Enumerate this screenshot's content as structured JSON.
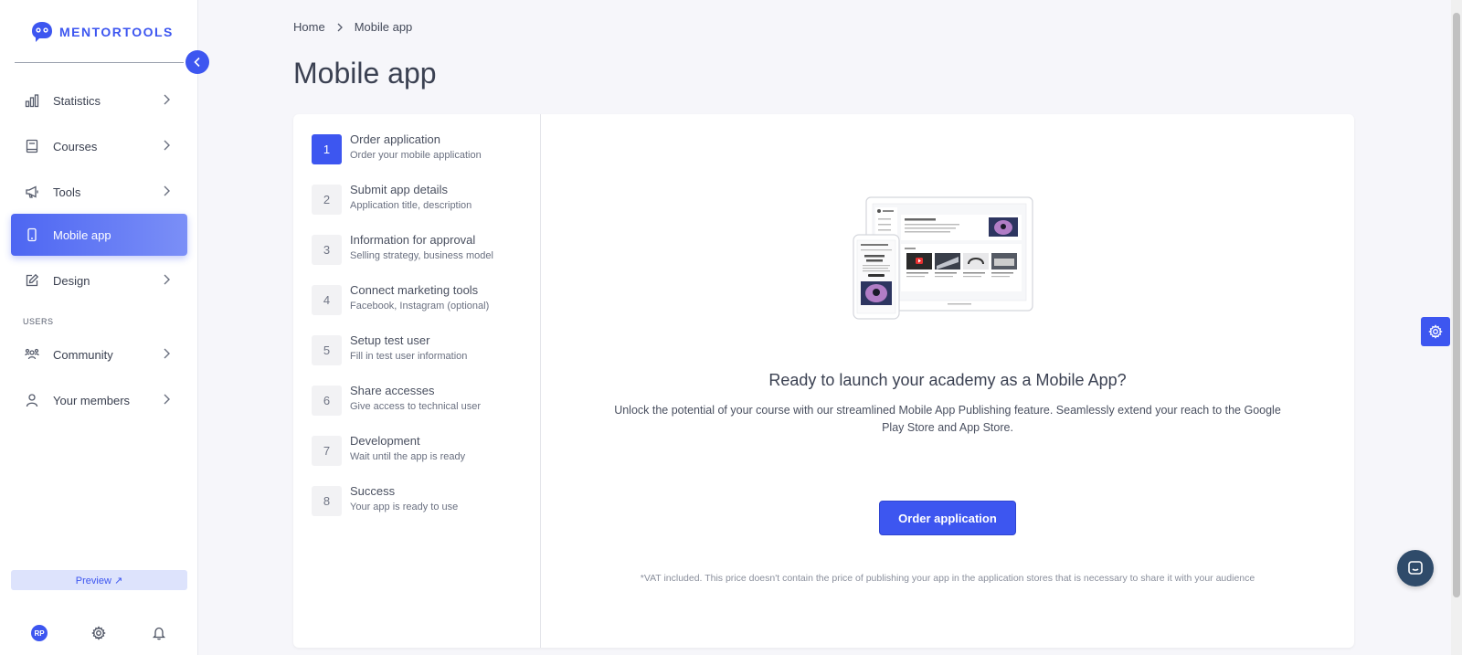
{
  "brand": {
    "name": "MENTORTOOLS",
    "accent": "#3d56f0"
  },
  "sidebar": {
    "items": [
      {
        "label": "Statistics",
        "icon": "bar-chart-icon"
      },
      {
        "label": "Courses",
        "icon": "book-icon"
      },
      {
        "label": "Tools",
        "icon": "megaphone-icon"
      },
      {
        "label": "Mobile app",
        "icon": "phone-icon",
        "active": true
      },
      {
        "label": "Design",
        "icon": "pencil-icon"
      }
    ],
    "users_section_label": "USERS",
    "user_items": [
      {
        "label": "Community",
        "icon": "community-icon"
      },
      {
        "label": "Your members",
        "icon": "person-icon"
      }
    ],
    "preview_label": "Preview ↗",
    "avatar_initials": "RP"
  },
  "breadcrumb": {
    "home": "Home",
    "separator": ">",
    "current": "Mobile app"
  },
  "page": {
    "title": "Mobile app"
  },
  "steps": [
    {
      "num": "1",
      "title": "Order application",
      "sub": "Order your mobile application",
      "active": true
    },
    {
      "num": "2",
      "title": "Submit app details",
      "sub": "Application title, description"
    },
    {
      "num": "3",
      "title": "Information for approval",
      "sub": "Selling strategy, business model"
    },
    {
      "num": "4",
      "title": "Connect marketing tools",
      "sub": "Facebook, Instagram (optional)"
    },
    {
      "num": "5",
      "title": "Setup test user",
      "sub": "Fill in test user information"
    },
    {
      "num": "6",
      "title": "Share accesses",
      "sub": "Give access to technical user"
    },
    {
      "num": "7",
      "title": "Development",
      "sub": "Wait until the app is ready"
    },
    {
      "num": "8",
      "title": "Success",
      "sub": "Your app is ready to use"
    }
  ],
  "content": {
    "headline": "Ready to launch your academy as a Mobile App?",
    "description": "Unlock the potential of your course with our streamlined Mobile App Publishing feature. Seamlessly extend your reach to the Google Play Store and App Store.",
    "order_button": "Order application",
    "vat_note": "*VAT included. This price doesn't contain the price of publishing your app in the application stores that is necessary to share it with your audience"
  }
}
